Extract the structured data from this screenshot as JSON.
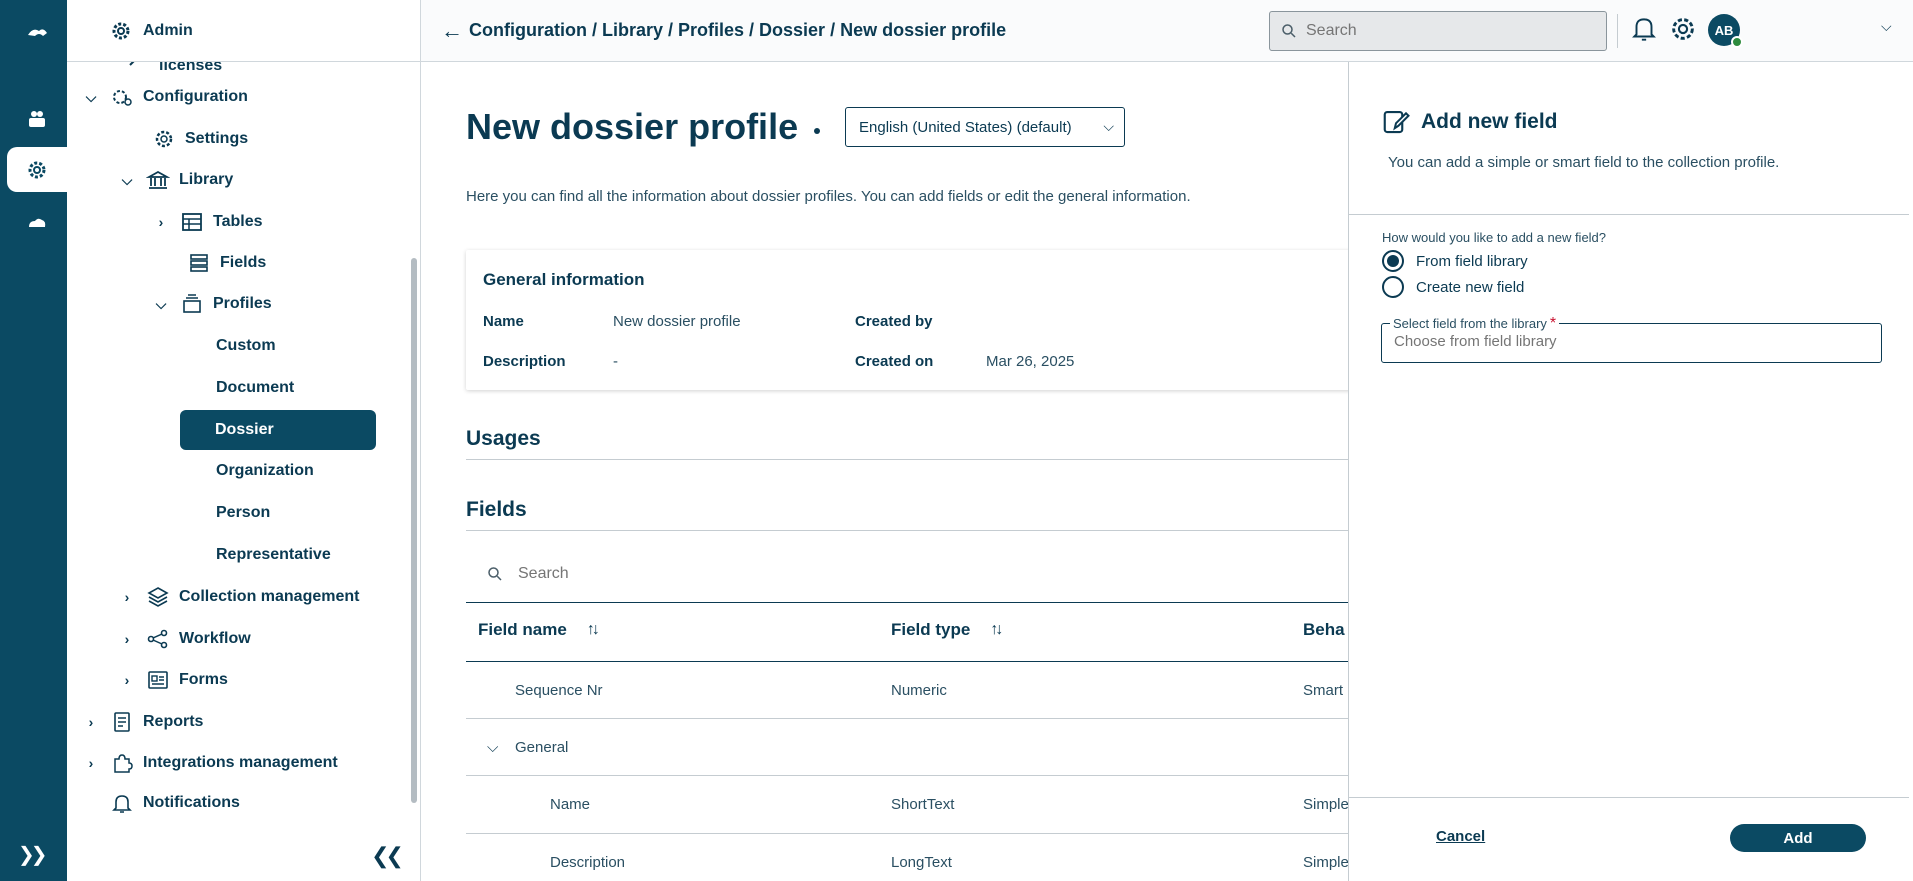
{
  "sidebar": {
    "header_title": "Admin",
    "items": {
      "licenses": "licenses",
      "configuration": "Configuration",
      "settings": "Settings",
      "library": "Library",
      "tables": "Tables",
      "fields": "Fields",
      "profiles": "Profiles",
      "custom": "Custom",
      "document": "Document",
      "dossier": "Dossier",
      "organization": "Organization",
      "person": "Person",
      "representative": "Representative",
      "collection_management": "Collection management",
      "workflow": "Workflow",
      "forms": "Forms",
      "reports": "Reports",
      "integrations_management": "Integrations management",
      "notifications": "Notifications"
    }
  },
  "topbar": {
    "breadcrumb": "Configuration / Library / Profiles / Dossier / New dossier profile",
    "search_placeholder": "Search",
    "avatar_initials": "AB"
  },
  "main": {
    "title": "New dossier profile",
    "language": "English (United States) (default)",
    "intro": "Here you can find all the information about dossier profiles. You can add fields or edit the general information.",
    "general": {
      "heading": "General information",
      "name_label": "Name",
      "name_value": "New dossier profile",
      "description_label": "Description",
      "description_value": "-",
      "created_by_label": "Created by",
      "created_on_label": "Created on",
      "created_on_value": "Mar 26, 2025"
    },
    "usages_heading": "Usages",
    "fields_heading": "Fields",
    "fields_search_placeholder": "Search",
    "columns": {
      "field_name": "Field name",
      "field_type": "Field type",
      "behavior": "Beha"
    },
    "rows": [
      {
        "name": "Sequence Nr",
        "type": "Numeric",
        "behavior": "Smart"
      },
      {
        "group": "General"
      },
      {
        "name": "Name",
        "type": "ShortText",
        "behavior": "Simple"
      },
      {
        "name": "Description",
        "type": "LongText",
        "behavior": "Simple"
      }
    ]
  },
  "drawer": {
    "title": "Add new field",
    "subtitle": "You can add a simple or smart field to the collection profile.",
    "question": "How would you like to add a new field?",
    "option_library": "From field library",
    "option_new": "Create new field",
    "select_label": "Select field from the library",
    "select_required_mark": "*",
    "select_placeholder": "Choose from field library",
    "cancel_label": "Cancel",
    "add_label": "Add"
  },
  "colors": {
    "primary": "#0b4a63",
    "text": "#0b3a52",
    "required": "#c8102e",
    "online": "#2e8b3e"
  }
}
